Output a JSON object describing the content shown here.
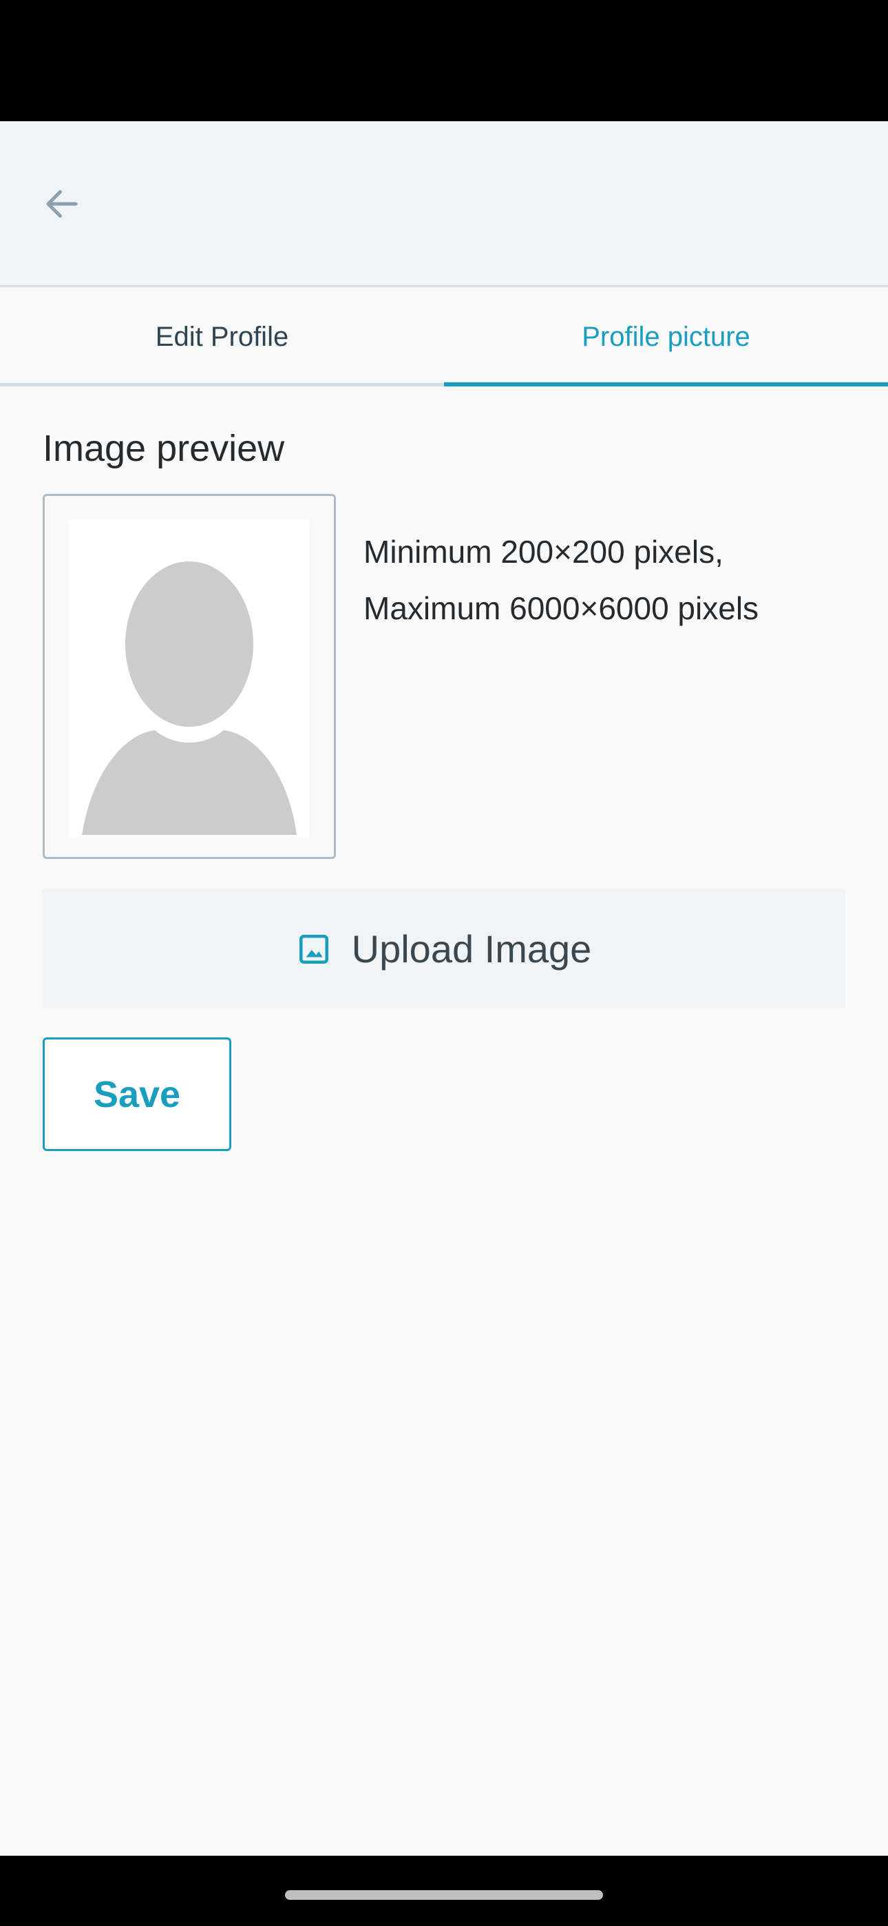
{
  "header": {
    "back_icon": "arrow-left-icon"
  },
  "tabs": [
    {
      "label": "Edit Profile",
      "active": false
    },
    {
      "label": "Profile picture",
      "active": true
    }
  ],
  "preview": {
    "title": "Image preview",
    "placeholder_icon": "avatar-placeholder-icon",
    "limits_line1": "Minimum 200×200 pixels,",
    "limits_line2": "Maximum 6000×6000 pixels"
  },
  "actions": {
    "upload_label": "Upload Image",
    "upload_icon": "image-icon",
    "save_label": "Save"
  },
  "colors": {
    "accent": "#1a9ebf",
    "header_bg": "#f1f4f7",
    "page_bg": "#f9f9f9",
    "text_primary": "#252a2e"
  }
}
